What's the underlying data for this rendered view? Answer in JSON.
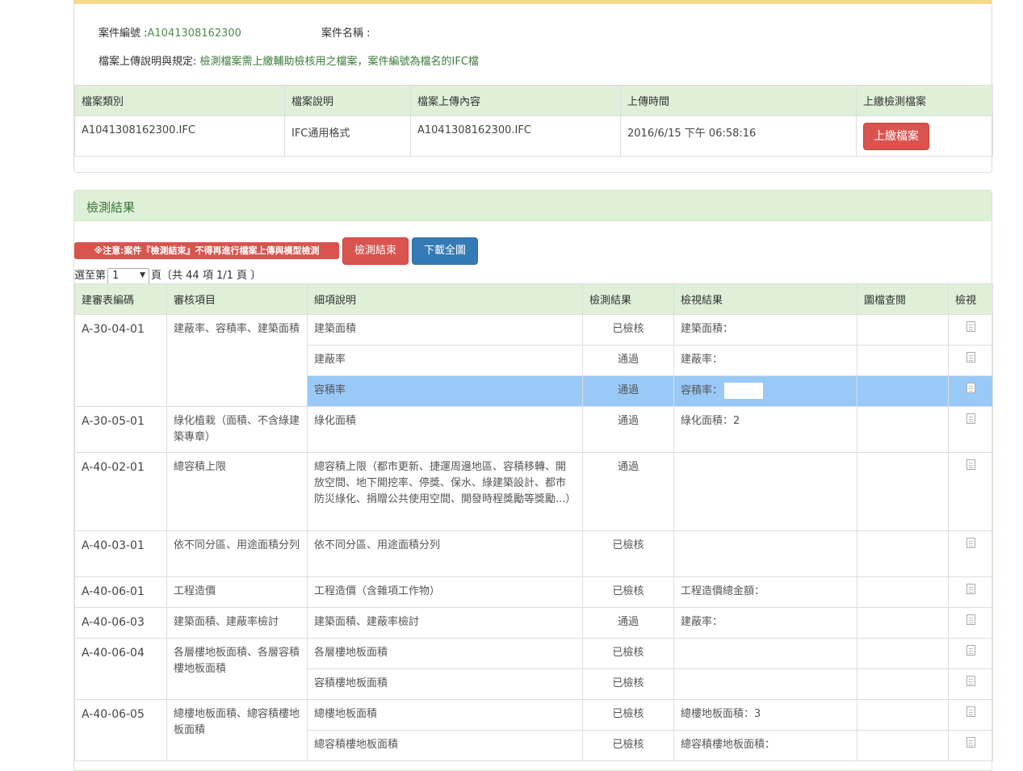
{
  "case": {
    "number_label": "案件編號 :",
    "number_value": "A1041308162300",
    "name_label": "案件名稱 :",
    "rule_label": "檔案上傳說明與規定:",
    "rule_value": "檢測檔案需上繳輔助檢核用之檔案，案件編號為檔名的IFC檔"
  },
  "file_table": {
    "headers": [
      "檔案類別",
      "檔案說明",
      "檔案上傳內容",
      "上傳時間",
      "上繳檢測檔案"
    ],
    "row": {
      "category": "A1041308162300.IFC",
      "desc": "IFC通用格式",
      "content": "A1041308162300.IFC",
      "time": "2016/6/15 下午 06:58:16",
      "button": "上繳檔案"
    }
  },
  "results": {
    "title": "檢測結果",
    "warning": "※注意:案件『檢測結束』不得再進行檔案上傳與模型檢測",
    "end_button": "檢測結束",
    "download_button": "下載全圖",
    "pager": {
      "prefix": "選至第",
      "page_value": "1",
      "suffix": "頁〔共 44 項 1/1 頁 〕"
    },
    "headers": [
      "建審表編碼",
      "審核項目",
      "細項說明",
      "檢測結果",
      "檢視結果",
      "圖檔查閱",
      "檢視"
    ],
    "rows": [
      {
        "code": "A-30-04-01",
        "item": "建蔽率、容積率、建築面積",
        "detail": "建築面積",
        "result": "已檢核",
        "view": "建築面積："
      },
      {
        "detail": "建蔽率",
        "result": "通過",
        "view": "建蔽率："
      },
      {
        "detail": "容積率",
        "result": "通過",
        "view": "容積率："
      },
      {
        "code": "A-30-05-01",
        "item": "綠化植栽（面積、不含綠建築專章）",
        "detail": "綠化面積",
        "result": "通過",
        "view": "綠化面積：2"
      },
      {
        "code": "A-40-02-01",
        "item": "總容積上限",
        "detail": "總容積上限（都市更新、捷運周邊地區、容積移轉、開放空間、地下開挖率、停獎、保水、綠建築設計、都市防災綠化、捐贈公共使用空間、開發時程獎勵等獎勵...）",
        "result": "通過",
        "view": ""
      },
      {
        "code": "A-40-03-01",
        "item": "依不同分區、用途面積分列",
        "detail": "依不同分區、用途面積分列",
        "result": "已檢核",
        "view": ""
      },
      {
        "code": "A-40-06-01",
        "item": "工程造價",
        "detail": "工程造價（含雜項工作物）",
        "result": "已檢核",
        "view": "工程造價總金額："
      },
      {
        "code": "A-40-06-03",
        "item": "建築面積、建蔽率檢討",
        "detail": "建築面積、建蔽率檢討",
        "result": "通過",
        "view": "建蔽率："
      },
      {
        "code": "A-40-06-04",
        "item": "各層樓地板面積、各層容積樓地板面積",
        "detail": "各層樓地板面積",
        "result": "已檢核",
        "view": ""
      },
      {
        "detail": "容積樓地板面積",
        "result": "已檢核",
        "view": ""
      },
      {
        "code": "A-40-06-05",
        "item": "總樓地板面積、總容積樓地板面積",
        "detail": "總樓地板面積",
        "result": "已檢核",
        "view": "總樓地板面積：3"
      },
      {
        "detail": "總容積樓地板面積",
        "result": "已檢核",
        "view": "總容積樓地板面積："
      }
    ]
  },
  "colors": {
    "header_green": "#dff0d8",
    "highlight_blue": "#99c9f7",
    "danger_red": "#d9534f",
    "primary_blue": "#337ab7",
    "top_accent": "#f7d98a"
  }
}
